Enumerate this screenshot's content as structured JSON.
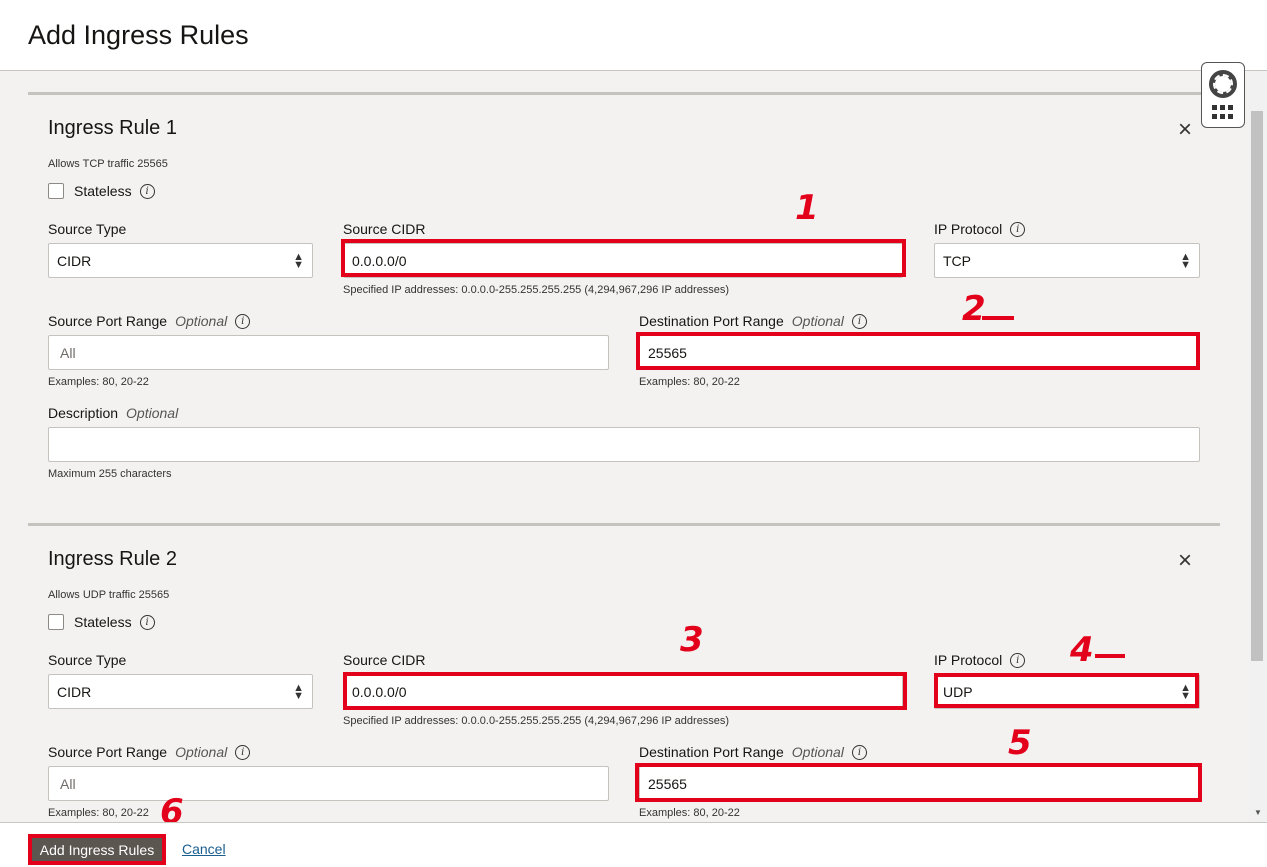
{
  "header": {
    "title": "Add Ingress Rules"
  },
  "rules": [
    {
      "title": "Ingress Rule 1",
      "summary": "Allows TCP traffic 25565",
      "stateless_label": "Stateless",
      "source_type_label": "Source Type",
      "source_type_value": "CIDR",
      "source_cidr_label": "Source CIDR",
      "source_cidr_value": "0.0.0.0/0",
      "source_cidr_hint": "Specified IP addresses: 0.0.0.0-255.255.255.255 (4,294,967,296 IP addresses)",
      "ip_protocol_label": "IP Protocol",
      "ip_protocol_value": "TCP",
      "source_port_label": "Source Port Range",
      "source_port_placeholder": "All",
      "source_port_hint": "Examples: 80, 20-22",
      "dest_port_label": "Destination Port Range",
      "dest_port_value": "25565",
      "dest_port_hint": "Examples: 80, 20-22",
      "description_label": "Description",
      "description_hint": "Maximum 255 characters"
    },
    {
      "title": "Ingress Rule 2",
      "summary": "Allows UDP traffic 25565",
      "stateless_label": "Stateless",
      "source_type_label": "Source Type",
      "source_type_value": "CIDR",
      "source_cidr_label": "Source CIDR",
      "source_cidr_value": "0.0.0.0/0",
      "source_cidr_hint": "Specified IP addresses: 0.0.0.0-255.255.255.255 (4,294,967,296 IP addresses)",
      "ip_protocol_label": "IP Protocol",
      "ip_protocol_value": "UDP",
      "source_port_label": "Source Port Range",
      "source_port_placeholder": "All",
      "source_port_hint": "Examples: 80, 20-22",
      "dest_port_label": "Destination Port Range",
      "dest_port_value": "25565",
      "dest_port_hint": "Examples: 80, 20-22"
    }
  ],
  "optional_label": "Optional",
  "info_glyph": "i",
  "close_glyph": "×",
  "annotations": [
    "1",
    "2",
    "3",
    "4",
    "5",
    "6"
  ],
  "footer": {
    "add_label": "Add Ingress Rules",
    "cancel_label": "Cancel"
  },
  "colors": {
    "highlight": "#e3001b",
    "primary_button": "#5c5651",
    "link": "#1a5d8f"
  }
}
